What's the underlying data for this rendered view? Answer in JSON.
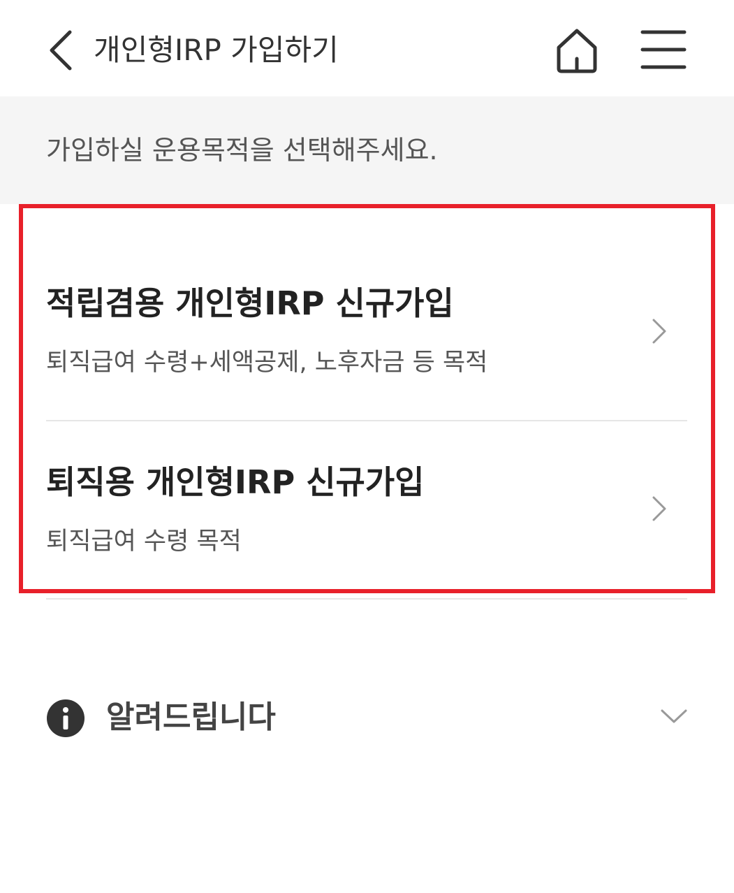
{
  "header": {
    "title": "개인형IRP 가입하기",
    "back_icon": "chevron-left-icon",
    "home_icon": "home-icon",
    "menu_icon": "hamburger-menu-icon"
  },
  "instruction": {
    "text": "가입하실 운용목적을 선택해주세요."
  },
  "options": [
    {
      "title": "적립겸용 개인형IRP 신규가입",
      "description": "퇴직급여 수령+세액공제, 노후자금 등 목적"
    },
    {
      "title": "퇴직용 개인형IRP 신규가입",
      "description": "퇴직급여 수령 목적"
    }
  ],
  "notice": {
    "label": "알려드립니다",
    "icon": "info-icon",
    "expand_icon": "chevron-down-icon"
  },
  "colors": {
    "highlight": "#e8202a",
    "band_background": "#f5f5f5",
    "divider": "#e6e6e6",
    "icon_dark": "#333333",
    "chevron_gray": "#999999"
  }
}
